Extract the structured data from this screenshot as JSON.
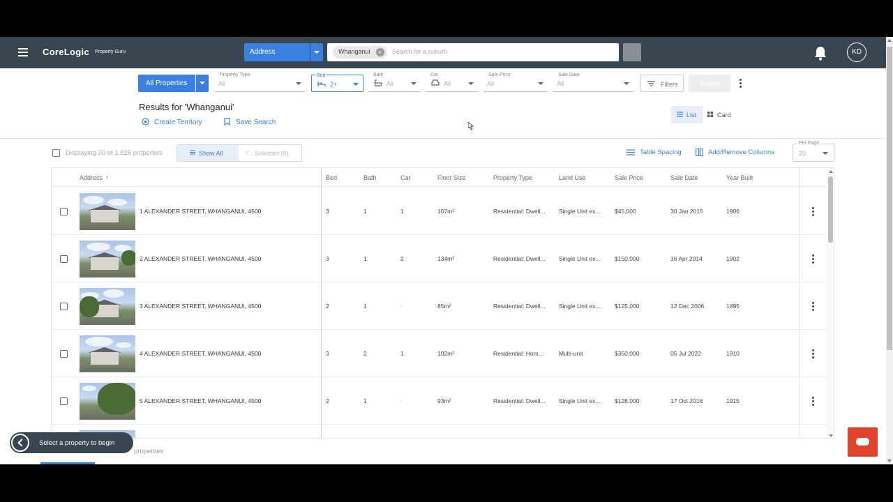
{
  "header": {
    "logo": "CoreLogic",
    "logo_sub": "Property Guru",
    "search_type": "Address",
    "search_chip": "Whanganui",
    "search_placeholder": "Search for a suburb",
    "avatar_initials": "KD"
  },
  "filters": {
    "all_properties": "All Properties",
    "property_type": {
      "label": "Property Type",
      "value": "All"
    },
    "bed": {
      "label": "Bed",
      "value": "2+"
    },
    "bath": {
      "label": "Bath",
      "value": "All"
    },
    "car": {
      "label": "Car",
      "value": "All"
    },
    "sale_price": {
      "label": "Sale Price",
      "value": "All"
    },
    "sale_date": {
      "label": "Sale Date",
      "value": "All"
    },
    "filters_label": "Filters",
    "search_label": "Search"
  },
  "results": {
    "title": "Results for 'Whanganui'",
    "create_territory": "Create Territory",
    "save_search": "Save Search",
    "view_list": "List",
    "view_card": "Card",
    "displaying": "Displaying 20 of 1,828 properties",
    "show_all": "Show All",
    "selected": "Selected (0)",
    "table_spacing": "Table Spacing",
    "add_remove_columns": "Add/Remove Columns",
    "per_page_label": "Per Page",
    "per_page_value": "20"
  },
  "table": {
    "columns": [
      "Address",
      "Bed",
      "Bath",
      "Car",
      "Floor Size",
      "Property Type",
      "Land Use",
      "Sale Price",
      "Sale Date",
      "Year Built"
    ],
    "rows": [
      {
        "address": "1 ALEXANDER STREET, WHANGANUI, 4500",
        "bed": "3",
        "bath": "1",
        "car": "1",
        "floor": "107m²",
        "ptype": "Residential: Dwell...",
        "land": "Single Unit ex...",
        "price": "$45,000",
        "date": "30 Jan 2015",
        "year": "1906"
      },
      {
        "address": "2 ALEXANDER STREET, WHANGANUI, 4500",
        "bed": "3",
        "bath": "1",
        "car": "2",
        "floor": "134m²",
        "ptype": "Residential: Dwell...",
        "land": "Single Unit ex...",
        "price": "$150,000",
        "date": "16 Apr 2014",
        "year": "1902"
      },
      {
        "address": "3 ALEXANDER STREET, WHANGANUI, 4500",
        "bed": "2",
        "bath": "1",
        "car": "-",
        "floor": "85m²",
        "ptype": "Residential: Dwell...",
        "land": "Single Unit ex...",
        "price": "$125,000",
        "date": "12 Dec 2006",
        "year": "1895"
      },
      {
        "address": "4 ALEXANDER STREET, WHANGANUI, 4500",
        "bed": "3",
        "bath": "2",
        "car": "1",
        "floor": "102m²",
        "ptype": "Residential: Hom...",
        "land": "Multi-unit",
        "price": "$350,000",
        "date": "05 Jul 2022",
        "year": "1910"
      },
      {
        "address": "5 ALEXANDER STREET, WHANGANUI, 4500",
        "bed": "2",
        "bath": "1",
        "car": "-",
        "floor": "93m²",
        "ptype": "Residential: Dwell...",
        "land": "Single Unit ex...",
        "price": "$128,000",
        "date": "17 Oct 2016",
        "year": "1915"
      }
    ]
  },
  "footer": {
    "toast": "Select a property to begin",
    "properties_text": "properties"
  },
  "colors": {
    "accent": "#3a80e0",
    "nav": "#3a4552",
    "chat": "#e0452b"
  }
}
